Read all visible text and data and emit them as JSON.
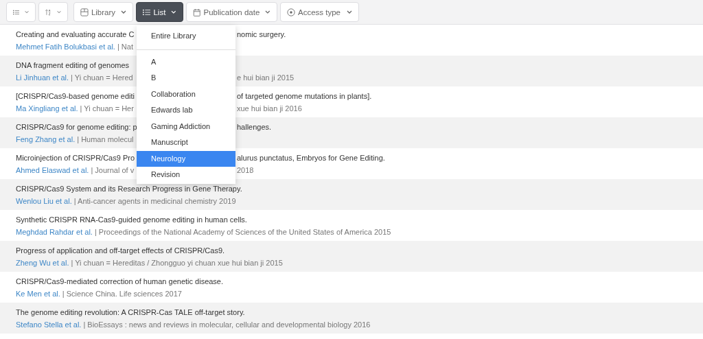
{
  "toolbar": {
    "buttons": [
      {
        "kind": "view",
        "active": false
      },
      {
        "kind": "sort",
        "active": false
      },
      {
        "kind": "library",
        "label": "Library",
        "active": false
      },
      {
        "kind": "list",
        "label": "List",
        "active": true
      },
      {
        "kind": "date",
        "label": "Publication date",
        "active": false
      },
      {
        "kind": "access",
        "label": "Access type",
        "active": false
      }
    ]
  },
  "list_menu": {
    "top_item": "Entire Library",
    "items": [
      {
        "label": "A",
        "selected": false
      },
      {
        "label": "B",
        "selected": false
      },
      {
        "label": "Collaboration",
        "selected": false
      },
      {
        "label": "Edwards lab",
        "selected": false
      },
      {
        "label": "Gaming Addiction",
        "selected": false
      },
      {
        "label": "Manuscript",
        "selected": false
      },
      {
        "label": "Neurology",
        "selected": true
      },
      {
        "label": "Revision",
        "selected": false
      }
    ]
  },
  "results": [
    {
      "title": [
        "Creating and evaluating accurate C",
        "nomic surgery."
      ],
      "authors": "Mehmet Fatih Bolukbasi et al.",
      "source": [
        "| Nat"
      ]
    },
    {
      "title": [
        "DNA fragment editing of genomes"
      ],
      "authors": "Li Jinhuan et al.",
      "source": [
        "| Yi chuan = Hered",
        "e hui bian ji 2015"
      ]
    },
    {
      "title": [
        "[CRISPR/Cas9-based genome editi",
        "of targeted genome mutations in plants]."
      ],
      "authors": "Ma Xingliang et al.",
      "source": [
        "| Yi chuan = Her",
        "xue hui bian ji 2016"
      ]
    },
    {
      "title": [
        "CRISPR/Cas9 for genome editing: p",
        "hallenges."
      ],
      "authors": "Feng Zhang et al.",
      "source": [
        "| Human molecul"
      ]
    },
    {
      "title": [
        "Microinjection of CRISPR/Cas9 Pro",
        "alurus punctatus, Embryos for Gene Editing."
      ],
      "authors": "Ahmed Elaswad et al.",
      "source": [
        "| Journal of v",
        "2018"
      ]
    },
    {
      "title": [
        "CRISPR/Cas9 System and its Research Progress in Gene Therapy."
      ],
      "authors": "Wenlou Liu et al.",
      "source": [
        "| Anti-cancer agents in medicinal chemistry 2019"
      ]
    },
    {
      "title": [
        "Synthetic CRISPR RNA-Cas9-guided genome editing in human cells."
      ],
      "authors": "Meghdad Rahdar et al.",
      "source": [
        "| Proceedings of the National Academy of Sciences of the United States of America 2015"
      ]
    },
    {
      "title": [
        "Progress of application and off-target effects of CRISPR/Cas9."
      ],
      "authors": "Zheng Wu et al.",
      "source": [
        "| Yi chuan = Hereditas / Zhongguo yi chuan xue hui bian ji 2015"
      ]
    },
    {
      "title": [
        "CRISPR/Cas9-mediated correction of human genetic disease."
      ],
      "authors": "Ke Men et al.",
      "source": [
        "| Science China. Life sciences 2017"
      ]
    },
    {
      "title": [
        "The genome editing revolution: A CRISPR-Cas TALE off-target story."
      ],
      "authors": "Stefano Stella et al.",
      "source": [
        "| BioEssays : news and reviews in molecular, cellular and developmental biology 2016"
      ]
    }
  ]
}
